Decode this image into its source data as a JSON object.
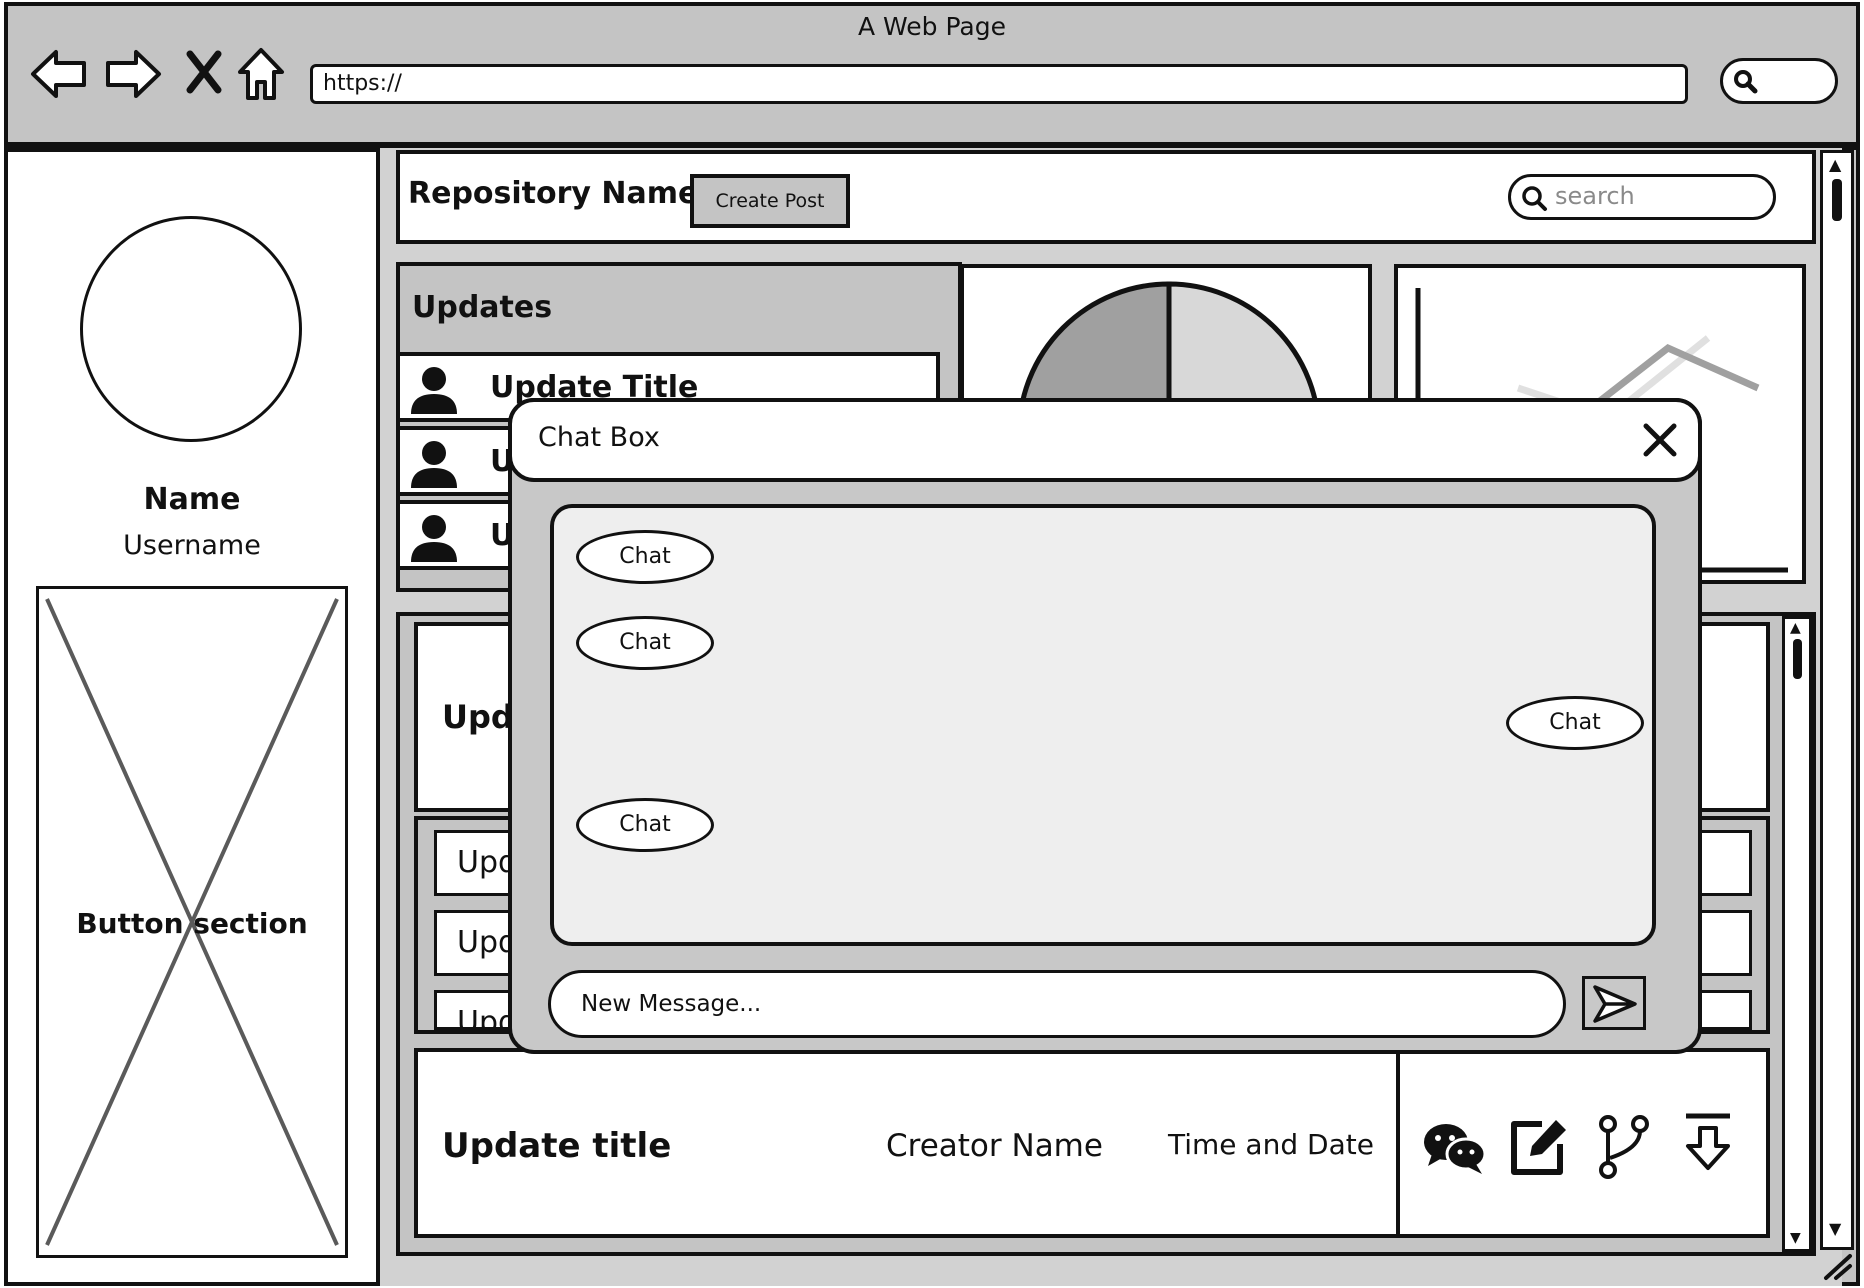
{
  "browser": {
    "title": "A Web Page",
    "url": "https://",
    "nav_icons": [
      "back-arrow-icon",
      "forward-arrow-icon",
      "close-icon",
      "home-icon"
    ]
  },
  "profile": {
    "name": "Name",
    "username": "Username",
    "button_section_label": "Button section"
  },
  "header": {
    "repository_name": "Repository Name",
    "create_post_label": "Create Post",
    "search_placeholder": "search"
  },
  "updates_panel": {
    "title": "Updates",
    "items": [
      {
        "title": "Update Title"
      },
      {
        "title": "U"
      },
      {
        "title": "U"
      }
    ]
  },
  "list": {
    "featured_title_partial": "Upd",
    "rows": [
      {
        "label": "Upd"
      },
      {
        "label": "Upd"
      },
      {
        "label": "Upd"
      }
    ],
    "footer_row": {
      "title": "Update title",
      "creator": "Creator Name",
      "time": "Time and Date"
    }
  },
  "chat": {
    "title": "Chat Box",
    "messages": [
      {
        "text": "Chat",
        "side": "left"
      },
      {
        "text": "Chat",
        "side": "left"
      },
      {
        "text": "Chat",
        "side": "right"
      },
      {
        "text": "Chat",
        "side": "left"
      }
    ],
    "input_placeholder": "New Message..."
  },
  "colors": {
    "chrome_gray": "#c4c4c4",
    "panel_gray": "#d2d2d2",
    "chat_area": "#eeeeee",
    "pie_dark": "#a0a0a0",
    "pie_light": "#d8d8d8"
  }
}
